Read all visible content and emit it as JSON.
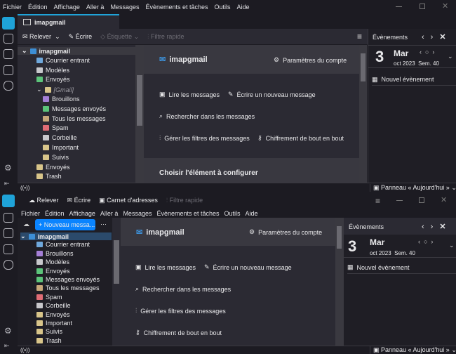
{
  "top": {
    "menu": [
      "Fichier",
      "Édition",
      "Affichage",
      "Aller à",
      "Messages",
      "Évènements et tâches",
      "Outils",
      "Aide"
    ],
    "window_controls": [
      "minimize",
      "maximize",
      "close"
    ],
    "tab": "imapgmail",
    "toolbar": {
      "get": "Relever",
      "write": "Écrire",
      "tag": "Étiquette",
      "quick_filter": "Filtre rapide"
    },
    "folders": [
      {
        "label": "imapgmail",
        "icon": "account-icon",
        "level": 0,
        "color": "#3d8fd6"
      },
      {
        "label": "Courrier entrant",
        "icon": "inbox-icon",
        "level": 1,
        "color": "#6fa8dc"
      },
      {
        "label": "Modèles",
        "icon": "templates-icon",
        "level": 1,
        "color": "#c8c8cc"
      },
      {
        "label": "Envoyés",
        "icon": "sent-icon",
        "level": 1,
        "color": "#5cc47a"
      },
      {
        "label": "[Gmail]",
        "icon": "folder-icon",
        "level": 1,
        "color": "#d8c58a"
      },
      {
        "label": "Brouillons",
        "icon": "drafts-icon",
        "level": 2,
        "color": "#a57fd6"
      },
      {
        "label": "Messages envoyés",
        "icon": "sent-icon",
        "level": 2,
        "color": "#5cc47a"
      },
      {
        "label": "Tous les messages",
        "icon": "archive-icon",
        "level": 2,
        "color": "#c7a87a"
      },
      {
        "label": "Spam",
        "icon": "spam-icon",
        "level": 2,
        "color": "#e06c75"
      },
      {
        "label": "Corbeille",
        "icon": "trash-icon",
        "level": 2,
        "color": "#c8c8cc"
      },
      {
        "label": "Important",
        "icon": "folder-icon",
        "level": 2,
        "color": "#d8c58a"
      },
      {
        "label": "Suivis",
        "icon": "folder-icon",
        "level": 2,
        "color": "#d8c58a"
      },
      {
        "label": "Envoyés",
        "icon": "folder-icon",
        "level": 1,
        "color": "#d8c58a"
      },
      {
        "label": "Trash",
        "icon": "folder-icon",
        "level": 1,
        "color": "#d8c58a"
      }
    ],
    "account": {
      "name": "imapgmail",
      "settings": "Paramètres du compte",
      "read": "Lire les messages",
      "write": "Écrire un nouveau message",
      "search": "Rechercher dans les messages",
      "filters": "Gérer les filtres des messages",
      "e2e": "Chiffrement de bout en bout",
      "configure": "Choisir l'élément à configurer"
    },
    "today": {
      "title": "Évènements",
      "day": "3",
      "weekday": "Mar",
      "month_week": "oct 2023  Sem. 40",
      "new_event": "Nouvel évènement"
    },
    "status": {
      "today_pane": "Panneau « Aujourd'hui »"
    }
  },
  "bottom": {
    "toolbar": {
      "get": "Relever",
      "write": "Écrire",
      "address_book": "Carnet d'adresses",
      "quick_filter": "Filtre rapide"
    },
    "menu": [
      "Fichier",
      "Édition",
      "Affichage",
      "Aller à",
      "Messages",
      "Évènements et tâches",
      "Outils",
      "Aide"
    ],
    "new_message": "+ Nouveau messa...",
    "more": "···",
    "folders": [
      {
        "label": "imapgmail",
        "level": 0,
        "color": "#3d8fd6"
      },
      {
        "label": "Courrier entrant",
        "level": 1,
        "color": "#6fa8dc"
      },
      {
        "label": "Brouillons",
        "level": 1,
        "color": "#a57fd6"
      },
      {
        "label": "Modèles",
        "level": 1,
        "color": "#c8c8cc"
      },
      {
        "label": "Envoyés",
        "level": 1,
        "color": "#5cc47a"
      },
      {
        "label": "Messages envoyés",
        "level": 1,
        "color": "#5cc47a"
      },
      {
        "label": "Tous les messages",
        "level": 1,
        "color": "#c7a87a"
      },
      {
        "label": "Spam",
        "level": 1,
        "color": "#e06c75"
      },
      {
        "label": "Corbeille",
        "level": 1,
        "color": "#c8c8cc"
      },
      {
        "label": "Envoyés",
        "level": 1,
        "color": "#d8c58a"
      },
      {
        "label": "Important",
        "level": 1,
        "color": "#d8c58a"
      },
      {
        "label": "Suivis",
        "level": 1,
        "color": "#d8c58a"
      },
      {
        "label": "Trash",
        "level": 1,
        "color": "#d8c58a"
      }
    ],
    "account": {
      "name": "imapgmail",
      "settings": "Paramètres du compte",
      "read": "Lire les messages",
      "write": "Écrire un nouveau message",
      "search": "Rechercher dans les messages",
      "filters": "Gérer les filtres des messages",
      "e2e": "Chiffrement de bout en bout"
    },
    "today": {
      "title": "Évènements",
      "day": "3",
      "weekday": "Mar",
      "month_week": "oct 2023  Sem. 40",
      "new_event": "Nouvel évènement"
    },
    "status": {
      "today_pane": "Panneau « Aujourd'hui »"
    }
  },
  "colors": {
    "accent": "#1fa3d8",
    "button": "#0a84ff"
  }
}
